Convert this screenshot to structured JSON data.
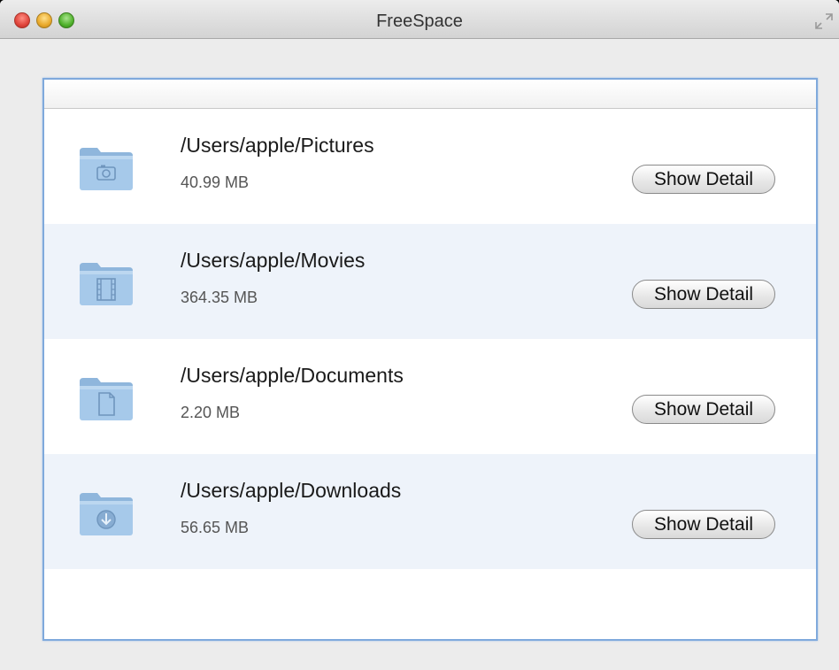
{
  "window": {
    "title": "FreeSpace"
  },
  "items": [
    {
      "path": "/Users/apple/Pictures",
      "size": "40.99 MB",
      "icon": "pictures-folder-icon",
      "button_label": "Show Detail"
    },
    {
      "path": "/Users/apple/Movies",
      "size": "364.35 MB",
      "icon": "movies-folder-icon",
      "button_label": "Show Detail"
    },
    {
      "path": "/Users/apple/Documents",
      "size": "2.20 MB",
      "icon": "documents-folder-icon",
      "button_label": "Show Detail"
    },
    {
      "path": "/Users/apple/Downloads",
      "size": "56.65 MB",
      "icon": "downloads-folder-icon",
      "button_label": "Show Detail"
    }
  ],
  "colors": {
    "folder": "#9fc4e6",
    "alt_row": "#eef3fa",
    "focus_ring": "#7fa9dc"
  }
}
